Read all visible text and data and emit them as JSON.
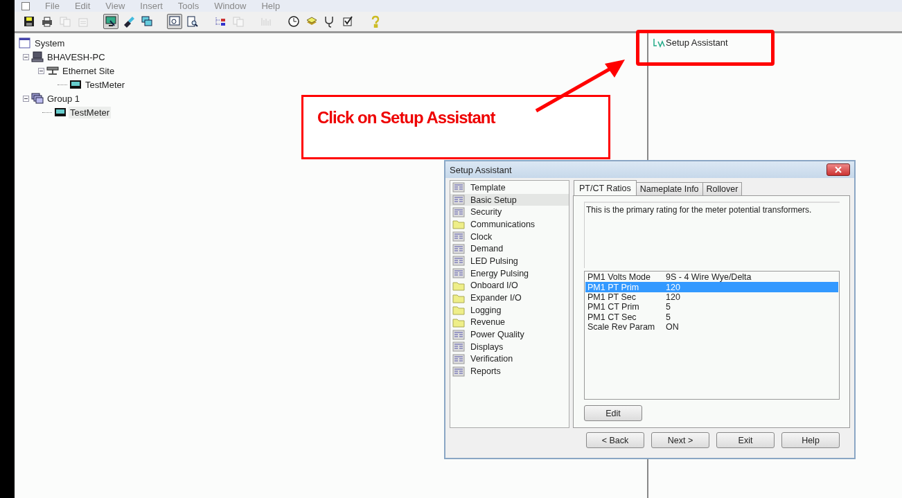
{
  "menu": [
    "File",
    "Edit",
    "View",
    "Insert",
    "Tools",
    "Window",
    "Help"
  ],
  "toolbar": [
    {
      "kind": "save",
      "disabled": false,
      "pressed": false
    },
    {
      "kind": "print",
      "disabled": false,
      "pressed": false
    },
    {
      "kind": "copy",
      "disabled": true,
      "pressed": false
    },
    {
      "kind": "properties",
      "disabled": true,
      "pressed": false
    },
    {
      "kind": "sep"
    },
    {
      "kind": "monitor",
      "disabled": false,
      "pressed": true
    },
    {
      "kind": "connect",
      "disabled": false,
      "pressed": false
    },
    {
      "kind": "windows",
      "disabled": false,
      "pressed": false
    },
    {
      "kind": "sep"
    },
    {
      "kind": "screen",
      "disabled": false,
      "pressed": true
    },
    {
      "kind": "preview",
      "disabled": false,
      "pressed": false
    },
    {
      "kind": "sep"
    },
    {
      "kind": "tree",
      "disabled": false,
      "pressed": false
    },
    {
      "kind": "copy",
      "disabled": true,
      "pressed": false
    },
    {
      "kind": "sep"
    },
    {
      "kind": "chart",
      "disabled": true,
      "pressed": false
    },
    {
      "kind": "sep"
    },
    {
      "kind": "clock",
      "disabled": false,
      "pressed": false
    },
    {
      "kind": "layers",
      "disabled": false,
      "pressed": false
    },
    {
      "kind": "stethoscope",
      "disabled": false,
      "pressed": false
    },
    {
      "kind": "check",
      "disabled": false,
      "pressed": false
    },
    {
      "kind": "sep"
    },
    {
      "kind": "help",
      "disabled": false,
      "pressed": false
    }
  ],
  "tree": [
    {
      "label": "System",
      "kind": "system",
      "selected": false,
      "children": [
        {
          "label": "BHAVESH-PC",
          "kind": "computer",
          "selected": false,
          "children": [
            {
              "label": "Ethernet Site",
              "kind": "network",
              "selected": false,
              "children": [
                {
                  "label": "TestMeter",
                  "kind": "meter",
                  "selected": false
                }
              ]
            }
          ]
        },
        {
          "label": "Group 1",
          "kind": "group",
          "selected": false,
          "children": [
            {
              "label": "TestMeter",
              "kind": "meter",
              "selected": true
            }
          ]
        }
      ]
    }
  ],
  "right_pane": {
    "items": [
      {
        "label": "Setup Assistant"
      }
    ]
  },
  "annotation": {
    "text": "Click on Setup Assistant"
  },
  "dialog": {
    "title": "Setup Assistant",
    "nav": [
      {
        "label": "Template",
        "kind": "page",
        "selected": false
      },
      {
        "label": "Basic Setup",
        "kind": "page",
        "selected": true
      },
      {
        "label": "Security",
        "kind": "page",
        "selected": false
      },
      {
        "label": "Communications",
        "kind": "folder",
        "selected": false
      },
      {
        "label": "Clock",
        "kind": "page",
        "selected": false
      },
      {
        "label": "Demand",
        "kind": "page",
        "selected": false
      },
      {
        "label": "LED Pulsing",
        "kind": "page",
        "selected": false
      },
      {
        "label": "Energy Pulsing",
        "kind": "page",
        "selected": false
      },
      {
        "label": "Onboard I/O",
        "kind": "folder",
        "selected": false
      },
      {
        "label": "Expander I/O",
        "kind": "folder",
        "selected": false
      },
      {
        "label": "Logging",
        "kind": "folder",
        "selected": false
      },
      {
        "label": "Revenue",
        "kind": "folder",
        "selected": false
      },
      {
        "label": "Power Quality",
        "kind": "page",
        "selected": false
      },
      {
        "label": "Displays",
        "kind": "page",
        "selected": false
      },
      {
        "label": "Verification",
        "kind": "page",
        "selected": false
      },
      {
        "label": "Reports",
        "kind": "page",
        "selected": false
      }
    ],
    "tabs": [
      {
        "label": "PT/CT Ratios",
        "selected": true
      },
      {
        "label": "Nameplate Info",
        "selected": false
      },
      {
        "label": "Rollover",
        "selected": false
      }
    ],
    "description": "This is the primary rating for the meter potential transformers.",
    "properties": [
      {
        "name": "PM1 Volts Mode",
        "value": "9S - 4 Wire Wye/Delta",
        "selected": false
      },
      {
        "name": "PM1 PT Prim",
        "value": "120",
        "selected": true
      },
      {
        "name": "PM1 PT Sec",
        "value": "120",
        "selected": false
      },
      {
        "name": "PM1 CT Prim",
        "value": "5",
        "selected": false
      },
      {
        "name": "PM1 CT Sec",
        "value": "5",
        "selected": false
      },
      {
        "name": "Scale Rev Param",
        "value": "ON",
        "selected": false
      }
    ],
    "edit_button": "Edit",
    "buttons": [
      "< Back",
      "Next >",
      "Exit",
      "Help"
    ]
  }
}
